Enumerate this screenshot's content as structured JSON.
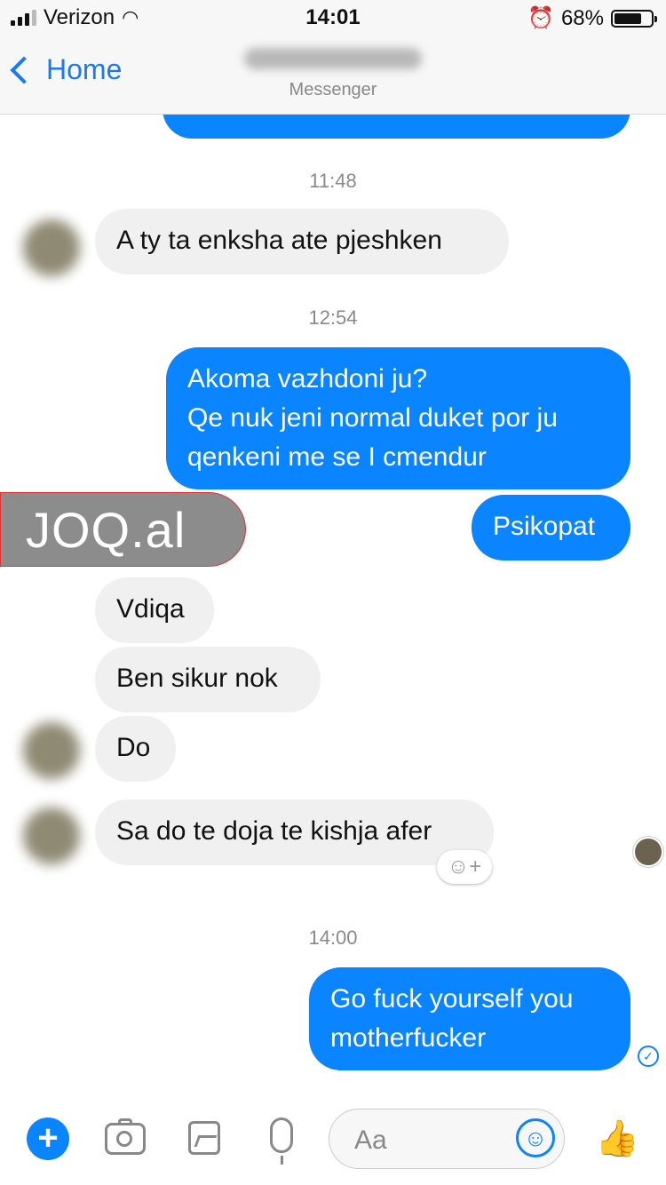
{
  "status_bar": {
    "carrier": "Verizon",
    "time": "14:01",
    "battery": "68%",
    "battery_level": 0.68
  },
  "nav": {
    "back_label": "Home",
    "subtitle": "Messenger"
  },
  "messages": {
    "top_partial": "",
    "ts1": "11:48",
    "in1": "A ty ta enksha ate pjeshken",
    "ts2": "12:54",
    "out1": "Akoma vazhdoni ju?\nQe nuk jeni normal duket por ju\nqenkeni me se I cmendur",
    "out2": "Psikopat",
    "watermark": "JOQ.al",
    "in2": "Vdiqa",
    "in3": "Ben sikur nok",
    "in4": "Do",
    "in5": "Sa do te doja te kishja afer",
    "reaction": "☺+",
    "ts3": "14:00",
    "out3": "Go fuck yourself you\nmotherfucker"
  },
  "composer": {
    "placeholder": "Aa"
  }
}
